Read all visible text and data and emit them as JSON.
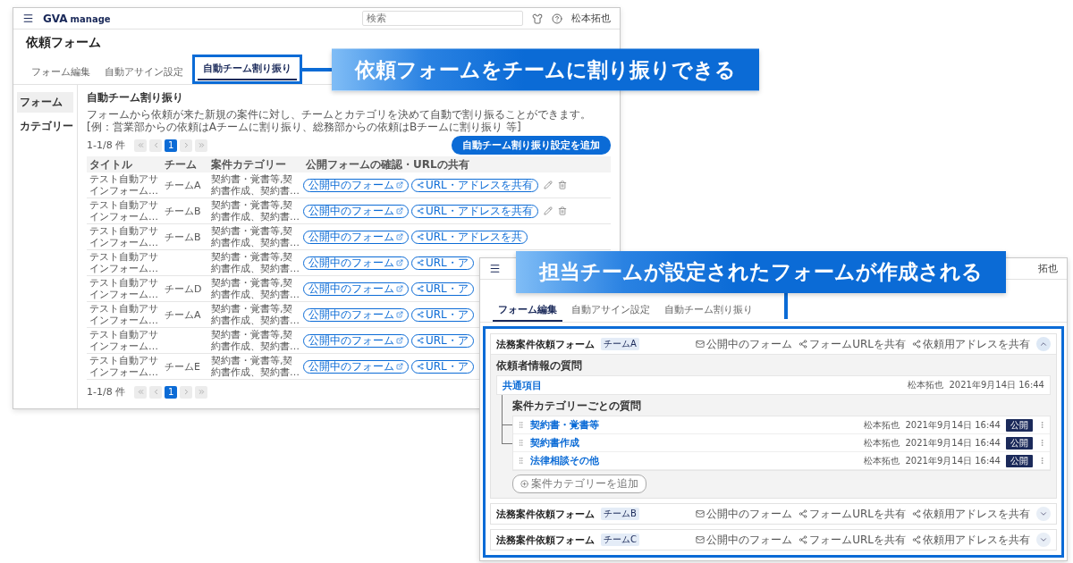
{
  "callouts": [
    "依頼フォームをチームに割り振りできる",
    "担当チームが設定されたフォームが作成される"
  ],
  "window_a": {
    "logo": {
      "brand": "GVA",
      "product": "manage"
    },
    "search": {
      "placeholder": "検索"
    },
    "user": "松本拓也",
    "title": "依頼フォーム",
    "tabs": [
      {
        "label": "フォーム編集",
        "selected": false,
        "highlighted": false
      },
      {
        "label": "自動アサイン設定",
        "selected": false,
        "highlighted": false
      },
      {
        "label": "自動チーム割り振り",
        "selected": true,
        "highlighted": true
      }
    ],
    "sidebar": [
      {
        "label": "フォーム",
        "selected": true
      },
      {
        "label": "カテゴリー",
        "selected": false
      }
    ],
    "section_title": "自動チーム割り振り",
    "description": [
      "フォームから依頼が来た新規の案件に対し、チームとカテゴリを決めて自動で割り振ることができます。",
      "[例：営業部からの依頼はAチームに割り振り、総務部からの依頼はBチームに割り振り 等]"
    ],
    "pagination_top": {
      "range": "1-1/8 件",
      "pages": [
        {
          "label": "1",
          "selected": true
        }
      ]
    },
    "add_button": "自動チーム割り振り設定を追加",
    "table": {
      "columns": [
        "タイトル",
        "チーム",
        "案件カテゴリー",
        "公開フォームの確認・URLの共有"
      ],
      "rows": [
        {
          "title": "テスト自動アサインフォーム…",
          "team": "チームA",
          "category": "契約書・覚書等,契約書作成、契約書…",
          "form_button": "公開中のフォーム",
          "share_button": "URL・アドレスを共有",
          "row_icons": [
            {
              "kind": "edit"
            },
            {
              "kind": "delete"
            }
          ]
        },
        {
          "title": "テスト自動アサインフォーム…",
          "team": "チームB",
          "category": "契約書・覚書等,契約書作成、契約書…",
          "form_button": "公開中のフォーム",
          "share_button": "URL・アドレスを共有",
          "row_icons": [
            {
              "kind": "edit"
            },
            {
              "kind": "delete"
            }
          ]
        },
        {
          "title": "テスト自動アサインフォーム…",
          "team": "チームB",
          "category": "契約書・覚書等,契約書作成、契約書…",
          "form_button": "公開中のフォーム",
          "share_button": "URL・アドレスを共"
        },
        {
          "title": "テスト自動アサインフォーム…",
          "category": "契約書・覚書等,契約書作成、契約書…",
          "form_button": "公開中のフォーム",
          "share_button": "URL・ア"
        },
        {
          "title": "テスト自動アサインフォーム…",
          "team": "チームD",
          "category": "契約書・覚書等,契約書作成、契約書…",
          "form_button": "公開中のフォーム",
          "share_button": "URL・ア"
        },
        {
          "title": "テスト自動アサインフォーム…",
          "team": "チームA",
          "category": "契約書・覚書等,契約書作成、契約書…",
          "form_button": "公開中のフォーム",
          "share_button": "URL・ア"
        },
        {
          "title": "テスト自動アサインフォーム…",
          "category": "契約書・覚書等,契約書作成、契約書…",
          "form_button": "公開中のフォーム",
          "share_button": "URL・ア"
        },
        {
          "title": "テスト自動アサインフォーム…",
          "team": "チームE",
          "category": "契約書・覚書等,契約書作成、契約書…",
          "form_button": "公開中のフォーム",
          "share_button": "URL・ア"
        }
      ]
    },
    "pagination_bottom": {
      "range": "1-1/8 件",
      "pages": [
        {
          "label": "1",
          "selected": true
        }
      ]
    }
  },
  "window_b": {
    "user": "拓也",
    "tabs": [
      {
        "label": "フォーム編集",
        "selected": true
      },
      {
        "label": "自動アサイン設定",
        "selected": false
      },
      {
        "label": "自動チーム割り振り",
        "selected": false
      }
    ],
    "forms": [
      {
        "name": "法務案件依頼フォーム",
        "team_tag": "チームA",
        "expanded": true,
        "actions": [
          {
            "kind": "mail",
            "label": "公開中のフォーム"
          },
          {
            "kind": "share",
            "label": "フォームURLを共有"
          },
          {
            "kind": "share",
            "label": "依頼用アドレスを共有"
          }
        ],
        "details": {
          "heading": "依頼者情報の質問",
          "common": {
            "title": "共通項目",
            "author": "松本拓也",
            "date": "2021年9月14日 16:44"
          },
          "category_heading": "案件カテゴリーごとの質問",
          "categories": [
            {
              "title": "契約書・覚書等",
              "author": "松本拓也",
              "date": "2021年9月14日 16:44",
              "status": "公開"
            },
            {
              "title": "契約書作成",
              "author": "松本拓也",
              "date": "2021年9月14日 16:44",
              "status": "公開"
            },
            {
              "title": "法律相談その他",
              "author": "松本拓也",
              "date": "2021年9月14日 16:44",
              "status": "公開"
            }
          ],
          "add_button": "案件カテゴリーを追加"
        }
      },
      {
        "name": "法務案件依頼フォーム",
        "team_tag": "チームB",
        "expanded": false,
        "actions": [
          {
            "kind": "mail",
            "label": "公開中のフォーム"
          },
          {
            "kind": "share",
            "label": "フォームURLを共有"
          },
          {
            "kind": "share",
            "label": "依頼用アドレスを共有"
          }
        ]
      },
      {
        "name": "法務案件依頼フォーム",
        "team_tag": "チームC",
        "expanded": false,
        "actions": [
          {
            "kind": "mail",
            "label": "公開中のフォーム"
          },
          {
            "kind": "share",
            "label": "フォームURLを共有"
          },
          {
            "kind": "share",
            "label": "依頼用アドレスを共有"
          }
        ]
      }
    ]
  }
}
